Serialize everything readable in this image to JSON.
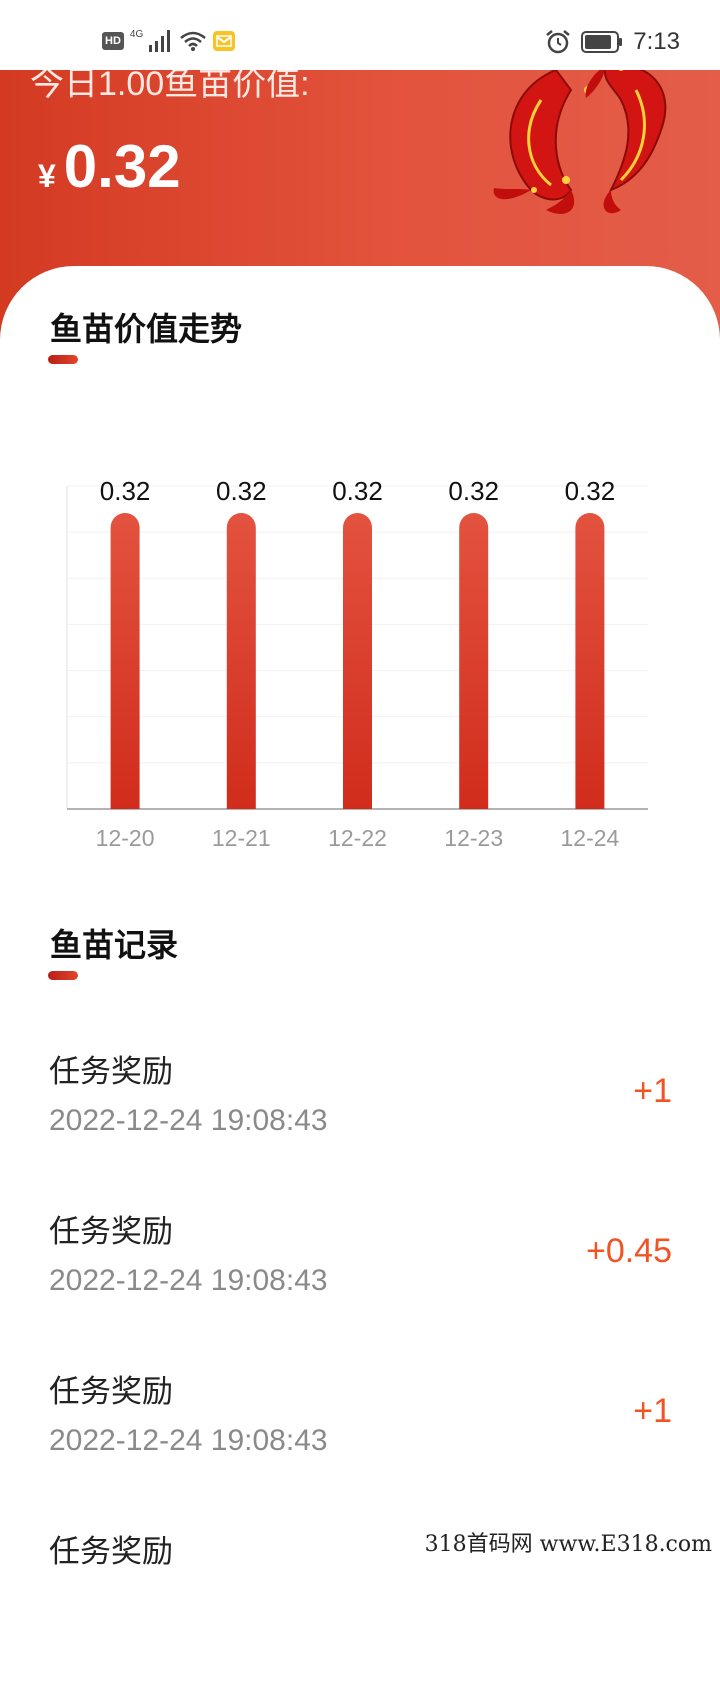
{
  "status_bar": {
    "hd": "HD",
    "network": "4G",
    "time": "7:13",
    "icons": [
      "signal-icon",
      "wifi-icon",
      "message-icon",
      "alarm-icon",
      "battery-icon"
    ]
  },
  "header": {
    "label": "今日1.00鱼苗价值:",
    "currency": "¥",
    "value": "0.32",
    "decoration": "koi-fish-pair"
  },
  "trend_section": {
    "title": "鱼苗价值走势"
  },
  "chart_data": {
    "type": "bar",
    "categories": [
      "12-20",
      "12-21",
      "12-22",
      "12-23",
      "12-24"
    ],
    "values": [
      0.32,
      0.32,
      0.32,
      0.32,
      0.32
    ],
    "data_labels": [
      "0.32",
      "0.32",
      "0.32",
      "0.32",
      "0.32"
    ],
    "ylim": [
      0,
      0.32
    ],
    "grid": true,
    "bar_color": "#d9392a"
  },
  "records_section": {
    "title": "鱼苗记录"
  },
  "records": [
    {
      "label": "任务奖励",
      "time": "2022-12-24 19:08:43",
      "amount": "+1"
    },
    {
      "label": "任务奖励",
      "time": "2022-12-24 19:08:43",
      "amount": "+0.45"
    },
    {
      "label": "任务奖励",
      "time": "2022-12-24 19:08:43",
      "amount": "+1"
    },
    {
      "label": "任务奖励",
      "time": "",
      "amount": ""
    }
  ],
  "watermark": "318首码网 www.E318.com",
  "colors": {
    "brand": "#d43a22",
    "amount": "#ee5424"
  }
}
